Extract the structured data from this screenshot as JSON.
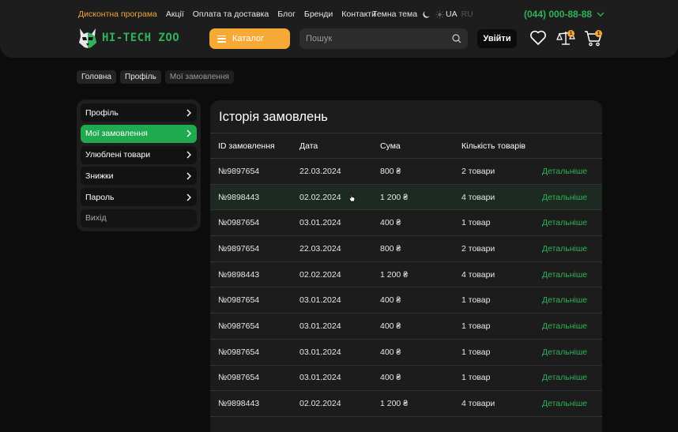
{
  "colors": {
    "accent_green": "#2fb35a",
    "accent_orange": "#f7a935",
    "panel": "#1c1c1c",
    "background": "#0c0c0c"
  },
  "topnav": {
    "items": [
      "Дисконтна програма",
      "Акції",
      "Оплата та доставка",
      "Блог",
      "Бренди",
      "Контакти"
    ],
    "theme_label": "Темна тема",
    "lang_active": "UA",
    "lang_inactive": "RU",
    "phone": "(044) 000-88-88"
  },
  "logo": {
    "text": "HI-TECH ZOO"
  },
  "header": {
    "catalog_label": "Каталог",
    "search_placeholder": "Пошук",
    "login_label": "Увійти",
    "compare_count": "1",
    "cart_count": "1"
  },
  "breadcrumb": [
    "Головна",
    "Профіль",
    "Мої замовлення"
  ],
  "sidebar": {
    "items": [
      {
        "label": "Профіль"
      },
      {
        "label": "Мої замовлення"
      },
      {
        "label": "Улюблені товари"
      },
      {
        "label": "Знижки"
      },
      {
        "label": "Пароль"
      }
    ],
    "exit_label": "Вихід"
  },
  "orders": {
    "title": "Історія замовлень",
    "columns": [
      "ID замовлення",
      "Дата",
      "Сума",
      "Кількість товарів"
    ],
    "rows": [
      {
        "id": "№9897654",
        "date": "22.03.2024",
        "sum": "800 ₴",
        "qty": "2 товари",
        "link": "Детальніше"
      },
      {
        "id": "№9898443",
        "date": "02.02.2024",
        "sum": "1 200 ₴",
        "qty": "4 товари",
        "link": "Детальніше"
      },
      {
        "id": "№0987654",
        "date": "03.01.2024",
        "sum": "400 ₴",
        "qty": "1 товар",
        "link": "Детальніше"
      },
      {
        "id": "№9897654",
        "date": "22.03.2024",
        "sum": "800 ₴",
        "qty": "2 товари",
        "link": "Детальніше"
      },
      {
        "id": "№9898443",
        "date": "02.02.2024",
        "sum": "1 200 ₴",
        "qty": "4 товари",
        "link": "Детальніше"
      },
      {
        "id": "№0987654",
        "date": "03.01.2024",
        "sum": "400 ₴",
        "qty": "1 товар",
        "link": "Детальніше"
      },
      {
        "id": "№0987654",
        "date": "03.01.2024",
        "sum": "400 ₴",
        "qty": "1 товар",
        "link": "Детальніше"
      },
      {
        "id": "№0987654",
        "date": "03.01.2024",
        "sum": "400 ₴",
        "qty": "1 товар",
        "link": "Детальніше"
      },
      {
        "id": "№0987654",
        "date": "03.01.2024",
        "sum": "400 ₴",
        "qty": "1 товар",
        "link": "Детальніше"
      },
      {
        "id": "№9898443",
        "date": "02.02.2024",
        "sum": "1 200 ₴",
        "qty": "4 товари",
        "link": "Детальніше"
      }
    ]
  }
}
